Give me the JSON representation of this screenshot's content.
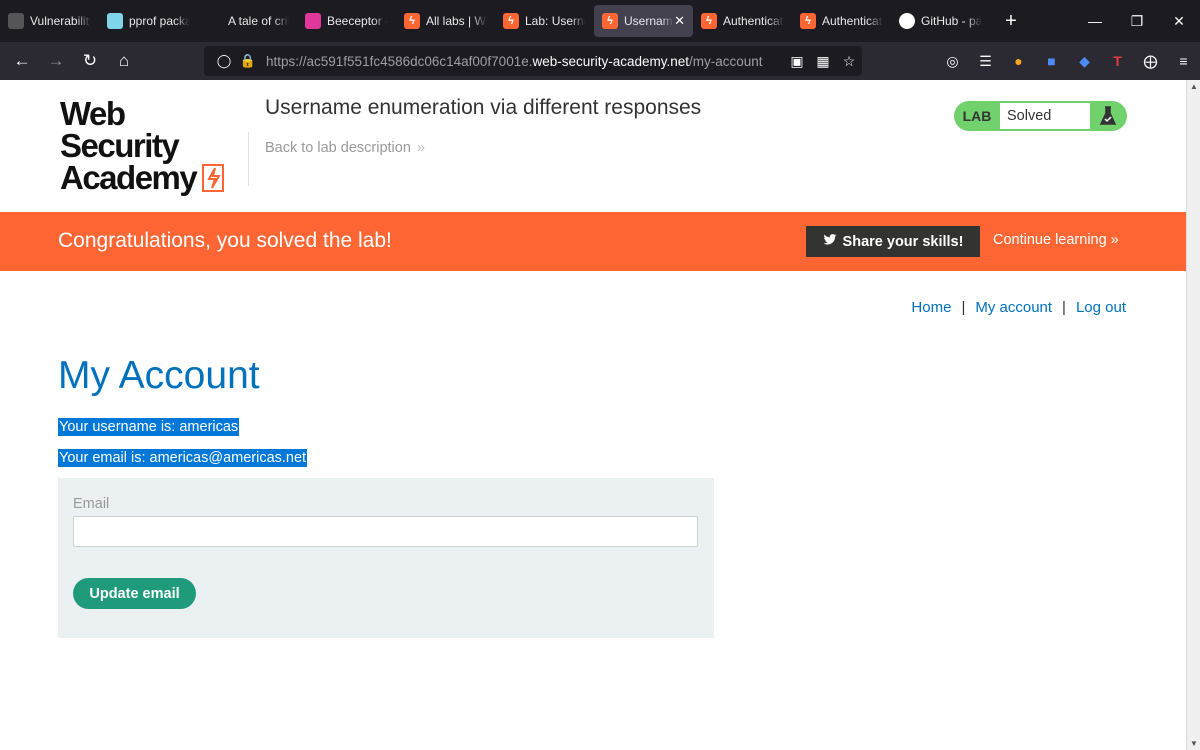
{
  "browser": {
    "tabs": [
      {
        "label": "Vulnerability",
        "icon": "monitor-icon",
        "color": "#555555"
      },
      {
        "label": "pprof packa",
        "icon": "go-icon",
        "color": "#7fd4ea"
      },
      {
        "label": "A tale of crit",
        "icon": "",
        "color": "#1c1b22"
      },
      {
        "label": "Beeceptor -",
        "icon": "beeceptor-icon",
        "color": "#e0389a"
      },
      {
        "label": "All labs | We",
        "icon": "portswigger-icon",
        "color": "#ff6633"
      },
      {
        "label": "Lab: Userna",
        "icon": "portswigger-icon",
        "color": "#ff6633"
      },
      {
        "label": "Username",
        "icon": "portswigger-icon",
        "color": "#ff6633"
      },
      {
        "label": "Authenticati",
        "icon": "portswigger-icon",
        "color": "#ff6633"
      },
      {
        "label": "Authenticati",
        "icon": "portswigger-icon",
        "color": "#ff6633"
      },
      {
        "label": "GitHub - pa",
        "icon": "github-icon",
        "color": "#ffffff"
      }
    ],
    "active_tab": 6,
    "url_prefix": "https://ac591f551fc4586dc06c14af00f7001e.",
    "url_host": "web-security-academy.net",
    "url_path": "/my-account"
  },
  "header": {
    "logo_line1": "Web Security",
    "logo_line2": "Academy",
    "lab_title": "Username enumeration via different responses",
    "back_link": "Back to lab description",
    "badge_lab": "LAB",
    "badge_status": "Solved"
  },
  "banner": {
    "message": "Congratulations, you solved the lab!",
    "share": "Share your skills!",
    "continue": "Continue learning"
  },
  "nav": {
    "home": "Home",
    "my_account": "My account",
    "log_out": "Log out",
    "separator": "|"
  },
  "main": {
    "title": "My Account",
    "username_line": "Your username is: americas",
    "email_line": "Your email is: americas@americas.net",
    "email_label": "Email",
    "email_value": "",
    "update_button": "Update email"
  },
  "colors": {
    "accent": "#ff6633",
    "link": "#0071bc",
    "badge": "#70d16d",
    "button": "#1f9a7a"
  }
}
